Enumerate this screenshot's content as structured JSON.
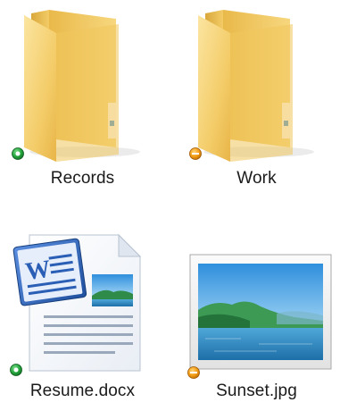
{
  "items": [
    {
      "name": "Records",
      "type": "folder",
      "status": "synced",
      "status_icon": "green-check-circle-icon"
    },
    {
      "name": "Work",
      "type": "folder",
      "status": "syncing",
      "status_icon": "orange-sync-circle-icon"
    },
    {
      "name": "Resume.docx",
      "type": "document",
      "status": "synced",
      "status_icon": "green-check-circle-icon",
      "app_badge": "W"
    },
    {
      "name": "Sunset.jpg",
      "type": "image",
      "status": "syncing",
      "status_icon": "orange-sync-circle-icon"
    }
  ],
  "colors": {
    "synced": "#23a33c",
    "syncing": "#f19a12",
    "folder": "#f5cc67",
    "word_blue": "#2b5eb5"
  }
}
